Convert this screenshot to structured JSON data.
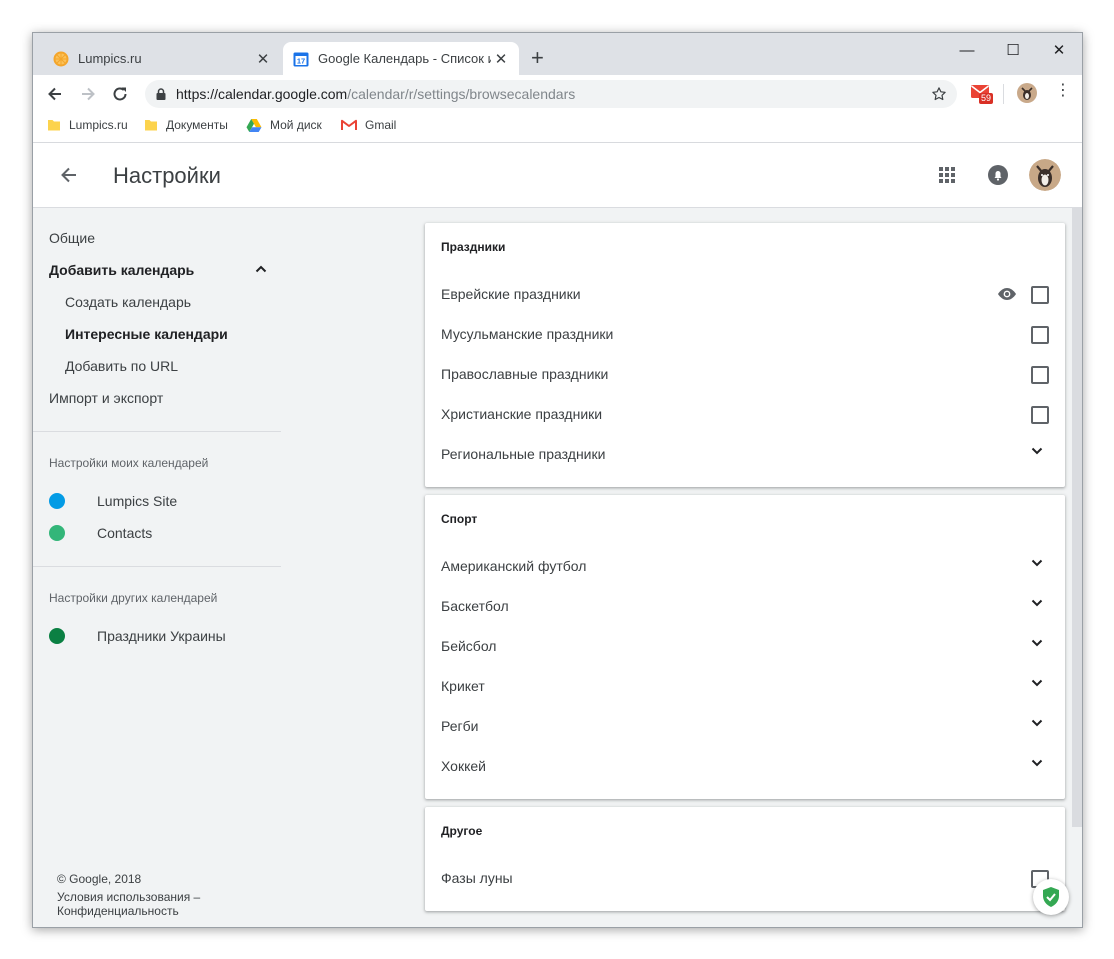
{
  "browser": {
    "tabs": [
      {
        "title": "Lumpics.ru",
        "favicon": "orange-slice-icon"
      },
      {
        "title": "Google Календарь - Список инт",
        "favicon": "google-calendar-icon",
        "favicon_text": "17"
      }
    ],
    "window_controls": [
      "minimize-icon",
      "maximize-icon",
      "close-icon"
    ],
    "url_domain": "https://calendar.google.com",
    "url_path": "/calendar/r/settings/browsecalendars",
    "gmail_badge": "59",
    "bookmarks": [
      {
        "label": "Lumpics.ru",
        "icon": "folder-icon"
      },
      {
        "label": "Документы",
        "icon": "folder-icon"
      },
      {
        "label": "Мой диск",
        "icon": "google-drive-icon"
      },
      {
        "label": "Gmail",
        "icon": "gmail-icon"
      }
    ]
  },
  "header": {
    "title": "Настройки"
  },
  "sidebar": {
    "general": "Общие",
    "add_calendar": "Добавить календарь",
    "create_calendar": "Создать календарь",
    "interesting_calendars": "Интересные календари",
    "add_by_url": "Добавить по URL",
    "import_export": "Импорт и экспорт",
    "my_calendars_heading": "Настройки моих календарей",
    "my_calendars": [
      {
        "name": "Lumpics Site",
        "color": "#039be5"
      },
      {
        "name": "Contacts",
        "color": "#33b679"
      }
    ],
    "other_calendars_heading": "Настройки других календарей",
    "other_calendars": [
      {
        "name": "Праздники Украины",
        "color": "#0b8043"
      }
    ],
    "footer": {
      "copyright": "© Google, 2018",
      "terms": "Условия использования",
      "separator": " –",
      "privacy": "Конфиденциальность"
    }
  },
  "cards": {
    "holidays": {
      "title": "Праздники",
      "items": [
        {
          "label": "Еврейские праздники",
          "control": "checkbox",
          "checked": false,
          "preview": true
        },
        {
          "label": "Мусульманские праздники",
          "control": "checkbox",
          "checked": false
        },
        {
          "label": "Православные праздники",
          "control": "checkbox",
          "checked": false
        },
        {
          "label": "Христианские праздники",
          "control": "checkbox",
          "checked": false
        },
        {
          "label": "Региональные праздники",
          "control": "expand"
        }
      ]
    },
    "sport": {
      "title": "Спорт",
      "items": [
        {
          "label": "Американский футбол",
          "control": "expand"
        },
        {
          "label": "Баскетбол",
          "control": "expand"
        },
        {
          "label": "Бейсбол",
          "control": "expand"
        },
        {
          "label": "Крикет",
          "control": "expand"
        },
        {
          "label": "Регби",
          "control": "expand"
        },
        {
          "label": "Хоккей",
          "control": "expand"
        }
      ]
    },
    "other": {
      "title": "Другое",
      "items": [
        {
          "label": "Фазы луны",
          "control": "checkbox",
          "checked": false
        }
      ]
    }
  },
  "colors": {
    "accent": "#1a73e8",
    "gmail_red": "#ea4335",
    "shield_green": "#34a853"
  }
}
